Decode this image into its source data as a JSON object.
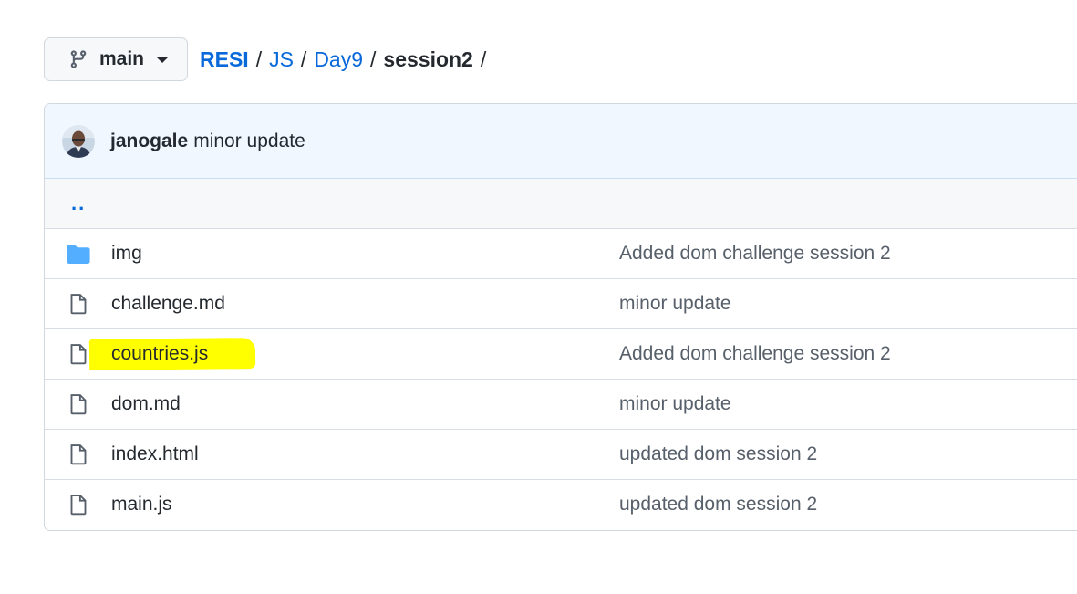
{
  "branch": {
    "name": "main",
    "icon": "git-branch-icon"
  },
  "breadcrumb": {
    "repo": "RESI",
    "sep": "/",
    "parts": [
      "JS",
      "Day9"
    ],
    "current": "session2"
  },
  "commit": {
    "author": "janogale",
    "message": "minor update"
  },
  "parent_dir": "..",
  "files": [
    {
      "name": "img",
      "type": "folder",
      "message": "Added dom challenge session 2"
    },
    {
      "name": "challenge.md",
      "type": "file",
      "message": "minor update"
    },
    {
      "name": "countries.js",
      "type": "file",
      "message": "Added dom challenge session 2",
      "highlighted": true
    },
    {
      "name": "dom.md",
      "type": "file",
      "message": "minor update"
    },
    {
      "name": "index.html",
      "type": "file",
      "message": "updated dom session 2"
    },
    {
      "name": "main.js",
      "type": "file",
      "message": "updated dom session 2"
    }
  ],
  "colors": {
    "link": "#0969da",
    "folder": "#54aeff",
    "highlight": "#ffff00",
    "header_bg": "#f0f7ff"
  }
}
